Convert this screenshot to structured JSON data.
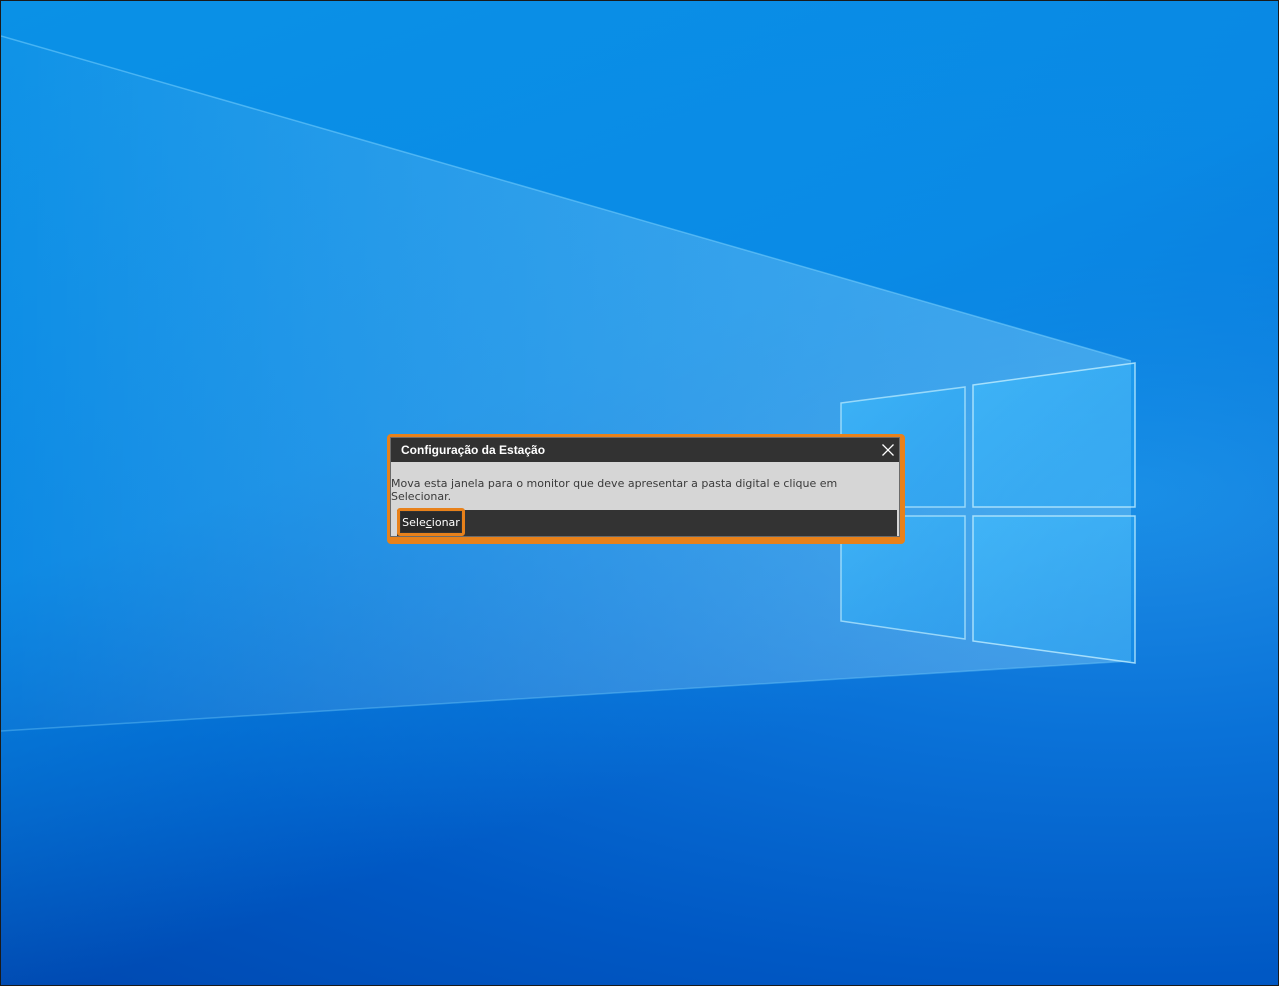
{
  "dialog": {
    "title": "Configuração da Estação",
    "message": "Mova esta janela para o monitor que deve apresentar a pasta digital e clique em Selecionar.",
    "select_label_before": "Sele",
    "select_label_mnemonic": "c",
    "select_label_after": "ionar"
  },
  "icons": {
    "close": "close-icon",
    "logo": "windows-logo"
  },
  "colors": {
    "accent": "#e8811a",
    "titlebar": "#323232",
    "dialog_bg": "#d6d6d6",
    "wallpaper": "#0a8fe8"
  }
}
